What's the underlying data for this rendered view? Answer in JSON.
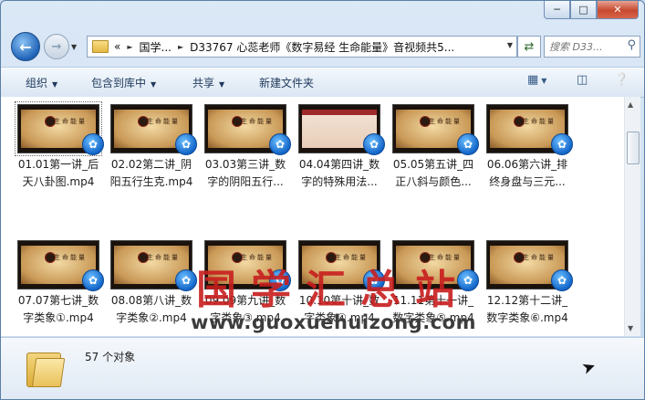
{
  "window": {
    "minimize_icon": "minimize-icon",
    "maximize_icon": "maximize-icon",
    "close_icon": "close-icon"
  },
  "nav": {
    "back_icon": "back-arrow-icon",
    "forward_icon": "forward-arrow-icon",
    "address_parts": [
      "«",
      "国学...",
      "D33767 心蕊老师《数字易经 生命能量》音视频共5..."
    ],
    "search_placeholder": "搜索 D33..."
  },
  "toolbar": {
    "organize": "组织",
    "include_library": "包含到库中",
    "share": "共享",
    "new_folder": "新建文件夹"
  },
  "files": [
    {
      "line1": "01.01第一讲_后",
      "line2": "天八卦图.mp4",
      "thumb": "paper"
    },
    {
      "line1": "02.02第二讲_阴",
      "line2": "阳五行生克.mp4",
      "thumb": "paper"
    },
    {
      "line1": "03.03第三讲_数",
      "line2": "字的阴阳五行...",
      "thumb": "paper"
    },
    {
      "line1": "04.04第四讲_数",
      "line2": "字的特殊用法...",
      "thumb": "screen"
    },
    {
      "line1": "05.05第五讲_四",
      "line2": "正八斜与颜色...",
      "thumb": "paper"
    },
    {
      "line1": "06.06第六讲_排",
      "line2": "终身盘与三元...",
      "thumb": "paper"
    },
    {
      "line1": "07.07第七讲_数",
      "line2": "字类象①.mp4",
      "thumb": "paper"
    },
    {
      "line1": "08.08第八讲_数",
      "line2": "字类象②.mp4",
      "thumb": "paper"
    },
    {
      "line1": "09.09第九讲_数",
      "line2": "字类象③.mp4",
      "thumb": "paper"
    },
    {
      "line1": "10.10第十讲_数",
      "line2": "字类象④.mp4",
      "thumb": "paper"
    },
    {
      "line1": "11.11第十一讲_",
      "line2": "数字类象⑤.mp4",
      "thumb": "paper"
    },
    {
      "line1": "12.12第十二讲_",
      "line2": "数字类象⑥.mp4",
      "thumb": "paper"
    }
  ],
  "thumb_title": "生命能量",
  "watermark": {
    "cn": "国学汇总站",
    "url": "www.guoxuehuizong.com"
  },
  "status": {
    "count": "57 个对象"
  }
}
